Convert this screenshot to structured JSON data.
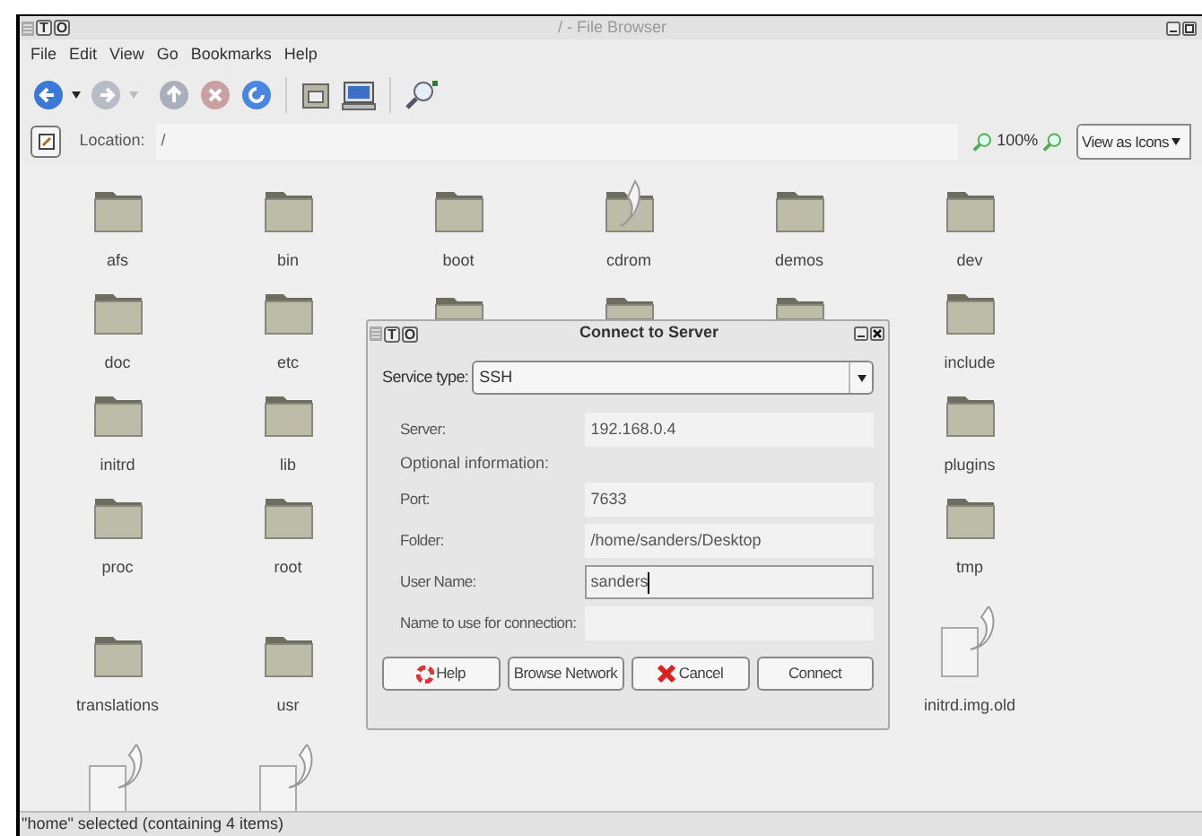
{
  "window": {
    "title": "/ - File Browser",
    "decor": [
      "T",
      "O"
    ]
  },
  "menu": [
    "File",
    "Edit",
    "View",
    "Go",
    "Bookmarks",
    "Help"
  ],
  "toolbar": [
    {
      "kind": "back",
      "disabled": false
    },
    {
      "kind": "forward",
      "disabled": true
    },
    {
      "kind": "up"
    },
    {
      "kind": "stop"
    },
    {
      "kind": "reload"
    },
    {
      "kind": "separator"
    },
    {
      "kind": "home"
    },
    {
      "kind": "computer"
    },
    {
      "kind": "separator"
    },
    {
      "kind": "search"
    }
  ],
  "location": {
    "label": "Location:",
    "value": "/",
    "zoom": "100%",
    "view": "View as Icons"
  },
  "rows": [
    [
      {
        "kind": "folder",
        "label": "afs"
      },
      {
        "kind": "folder",
        "label": "bin"
      },
      {
        "kind": "folder",
        "label": "boot"
      },
      {
        "kind": "folder-link",
        "label": "cdrom"
      },
      {
        "kind": "folder",
        "label": "demos"
      },
      {
        "kind": "folder",
        "label": "dev"
      }
    ],
    [
      {
        "kind": "folder",
        "label": "doc"
      },
      {
        "kind": "folder",
        "label": "etc"
      },
      {
        "kind": "folder-top"
      },
      {
        "kind": "folder-top"
      },
      {
        "kind": "folder-top"
      },
      {
        "kind": "folder",
        "label": "include"
      }
    ],
    [
      {
        "kind": "folder",
        "label": "initrd"
      },
      {
        "kind": "folder",
        "label": "lib"
      },
      {
        "kind": "covered"
      },
      {
        "kind": "covered"
      },
      {
        "kind": "covered"
      },
      {
        "kind": "folder",
        "label": "plugins"
      }
    ],
    [
      {
        "kind": "folder",
        "label": "proc"
      },
      {
        "kind": "folder",
        "label": "root"
      },
      {
        "kind": "covered"
      },
      {
        "kind": "covered"
      },
      {
        "kind": "covered"
      },
      {
        "kind": "folder",
        "label": "tmp"
      }
    ],
    [
      {
        "kind": "folder",
        "label": "translations"
      },
      {
        "kind": "folder",
        "label": "usr"
      },
      {
        "kind": "covered"
      },
      {
        "kind": "covered"
      },
      {
        "kind": "covered"
      },
      {
        "kind": "file-link",
        "label": "initrd.img.old"
      }
    ],
    [
      {
        "kind": "file-link"
      },
      {
        "kind": "file-link"
      }
    ]
  ],
  "dialog": {
    "title": "Connect to Server",
    "decor": [
      "T",
      "O"
    ],
    "service": {
      "label": "Service type:",
      "value": "SSH"
    },
    "fields": [
      {
        "kind": "field",
        "label": "Server:",
        "value": "192.168.0.4",
        "focused": false
      },
      {
        "kind": "heading",
        "label": "Optional information:"
      },
      {
        "kind": "field",
        "label": "Port:",
        "value": "7633",
        "focused": false
      },
      {
        "kind": "field",
        "label": "Folder:",
        "value": "/home/sanders/Desktop",
        "focused": false
      },
      {
        "kind": "field",
        "label": "User Name:",
        "value": "sanders",
        "focused": true
      },
      {
        "kind": "field",
        "label": "Name to use for connection:",
        "focused": false
      }
    ],
    "buttons": [
      {
        "kind": "help",
        "label": "Help"
      },
      {
        "kind": "plain",
        "label": "Browse Network"
      },
      {
        "kind": "cancel",
        "label": "Cancel"
      },
      {
        "kind": "plain",
        "label": "Connect"
      }
    ]
  },
  "status_bar": "\"home\" selected (containing 4 items)"
}
